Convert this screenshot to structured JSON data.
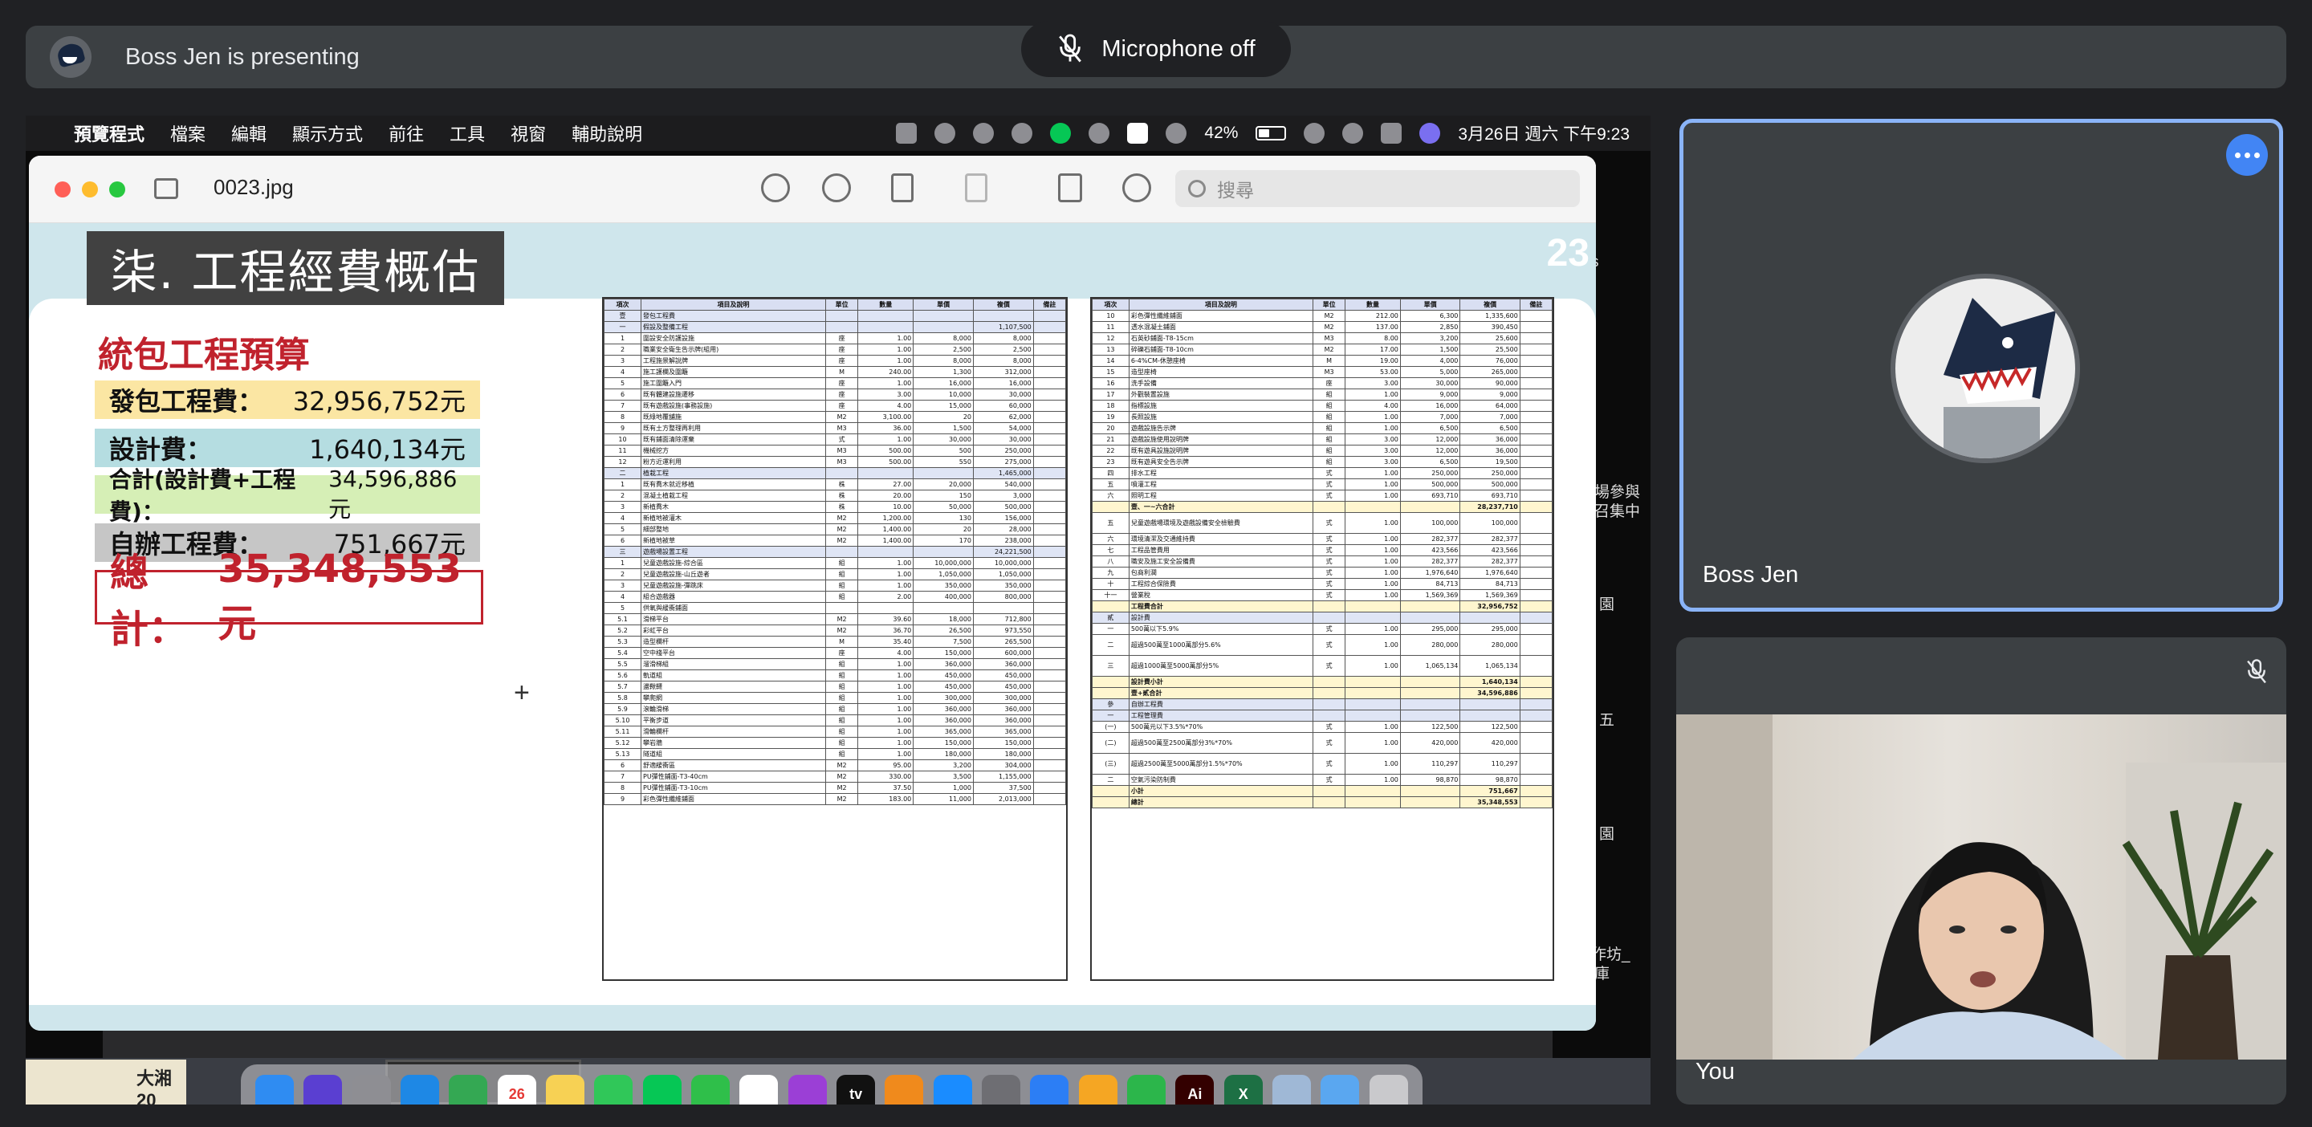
{
  "meet": {
    "presenting_text": "Boss Jen is presenting",
    "mic_status": "Microphone off",
    "tiles": [
      {
        "name": "Boss Jen"
      },
      {
        "name": "You"
      }
    ]
  },
  "mac": {
    "menubar": [
      "預覽程式",
      "檔案",
      "編輯",
      "顯示方式",
      "前往",
      "工具",
      "視窗",
      "輔助說明"
    ],
    "battery": "42%",
    "datetime": "3月26日 週六 下午9:23"
  },
  "preview": {
    "file_name": "0023.jpg",
    "search_placeholder": "搜尋"
  },
  "slide": {
    "page_number": "23",
    "title": "柒. 工程經費概估",
    "subtitle": "統包工程預算",
    "lines": [
      {
        "label": "發包工程費：",
        "value": "32,956,752元",
        "color": "#fbe6a3"
      },
      {
        "label": "設計費：",
        "value": "1,640,134元",
        "color": "#b5dde1"
      },
      {
        "label": "合計(設計費+工程費)：",
        "value": "34,596,886元",
        "color": "#d6efb6"
      },
      {
        "label": "自辦工程費：",
        "value": "751,667元",
        "color": "#c6c6c6"
      }
    ],
    "total_label": "總計：",
    "total_value": "35,348,553元",
    "sheet_headers": [
      "項次",
      "項目及說明",
      "單位",
      "數量",
      "單價",
      "複價",
      "備註"
    ],
    "sheet_left": [
      [
        "壹",
        "發包工程費",
        "",
        "",
        "",
        "",
        ""
      ],
      [
        "一",
        "假設及整備工程",
        "",
        "",
        "",
        "1,107,500",
        ""
      ],
      [
        "1",
        "圍設安全防護設施",
        "座",
        "1.00",
        "8,000",
        "8,000",
        ""
      ],
      [
        "2",
        "職業安全衛生告示牌(組用)",
        "座",
        "1.00",
        "2,500",
        "2,500",
        ""
      ],
      [
        "3",
        "工程施景解說牌",
        "座",
        "1.00",
        "8,000",
        "8,000",
        ""
      ],
      [
        "4",
        "施工護欄及圍籬",
        "M",
        "240.00",
        "1,300",
        "312,000",
        ""
      ],
      [
        "5",
        "施工圍籬入門",
        "座",
        "1.00",
        "16,000",
        "16,000",
        ""
      ],
      [
        "6",
        "既有體建設施遷移",
        "座",
        "3.00",
        "10,000",
        "30,000",
        ""
      ],
      [
        "7",
        "既有遊戲設施(事務設施)",
        "座",
        "4.00",
        "15,000",
        "60,000",
        ""
      ],
      [
        "8",
        "既綠地覆舖施",
        "M2",
        "3,100.00",
        "20",
        "62,000",
        ""
      ],
      [
        "9",
        "既有土方整理再利用",
        "M3",
        "36.00",
        "1,500",
        "54,000",
        ""
      ],
      [
        "10",
        "既有鋪面清除運棄",
        "式",
        "1.00",
        "30,000",
        "30,000",
        ""
      ],
      [
        "11",
        "機械挖方",
        "M3",
        "500.00",
        "500",
        "250,000",
        ""
      ],
      [
        "12",
        "粉方近運利用",
        "M3",
        "500.00",
        "550",
        "275,000",
        ""
      ],
      [
        "二",
        "植栽工程",
        "",
        "",
        "",
        "1,465,000",
        ""
      ],
      [
        "1",
        "既有喬木就近移植",
        "株",
        "27.00",
        "20,000",
        "540,000",
        ""
      ],
      [
        "2",
        "混凝土植栽工程",
        "株",
        "20.00",
        "150",
        "3,000",
        ""
      ],
      [
        "3",
        "新植喬木",
        "株",
        "10.00",
        "50,000",
        "500,000",
        ""
      ],
      [
        "4",
        "新植地被灌木",
        "M2",
        "1,200.00",
        "130",
        "156,000",
        ""
      ],
      [
        "5",
        "細部整地",
        "M2",
        "1,400.00",
        "20",
        "28,000",
        ""
      ],
      [
        "6",
        "新植地被草",
        "M2",
        "1,400.00",
        "170",
        "238,000",
        ""
      ],
      [
        "三",
        "遊戲場設置工程",
        "",
        "",
        "",
        "24,221,500",
        ""
      ],
      [
        "1",
        "兒童遊戲設施-綜合區",
        "組",
        "1.00",
        "10,000,000",
        "10,000,000",
        ""
      ],
      [
        "2",
        "兒童遊戲設施-山丘遊者",
        "組",
        "1.00",
        "1,050,000",
        "1,050,000",
        ""
      ],
      [
        "3",
        "兒童遊戲設施-彈跳床",
        "組",
        "1.00",
        "350,000",
        "350,000",
        ""
      ],
      [
        "4",
        "組合遊戲器",
        "組",
        "2.00",
        "400,000",
        "800,000",
        ""
      ],
      [
        "5",
        "供氧與緩衝鋪面",
        "",
        "",
        "",
        "",
        ""
      ],
      [
        "5.1",
        "滑梯平台",
        "M2",
        "39.60",
        "18,000",
        "712,800",
        ""
      ],
      [
        "5.2",
        "彩虹平台",
        "M2",
        "36.70",
        "26,500",
        "973,550",
        ""
      ],
      [
        "5.3",
        "造型欄杆",
        "M",
        "35.40",
        "7,500",
        "265,500",
        ""
      ],
      [
        "5.4",
        "空中棧平台",
        "座",
        "4.00",
        "150,000",
        "600,000",
        ""
      ],
      [
        "5.5",
        "溜滑梯組",
        "組",
        "1.00",
        "360,000",
        "360,000",
        ""
      ],
      [
        "5.6",
        "軌道組",
        "組",
        "1.00",
        "450,000",
        "450,000",
        ""
      ],
      [
        "5.7",
        "盪鞦韆",
        "組",
        "1.00",
        "450,000",
        "450,000",
        ""
      ],
      [
        "5.8",
        "攀爬網",
        "組",
        "1.00",
        "300,000",
        "300,000",
        ""
      ],
      [
        "5.9",
        "滾輪滑梯",
        "組",
        "1.00",
        "360,000",
        "360,000",
        ""
      ],
      [
        "5.10",
        "平衡步道",
        "組",
        "1.00",
        "360,000",
        "360,000",
        ""
      ],
      [
        "5.11",
        "滑輪欄杆",
        "組",
        "1.00",
        "365,000",
        "365,000",
        ""
      ],
      [
        "5.12",
        "攀岩牆",
        "組",
        "1.00",
        "150,000",
        "150,000",
        ""
      ],
      [
        "5.13",
        "隧道組",
        "組",
        "1.00",
        "180,000",
        "180,000",
        ""
      ],
      [
        "6",
        "舒適緩衝區",
        "M2",
        "95.00",
        "3,200",
        "304,000",
        ""
      ],
      [
        "7",
        "PU彈性鋪面-T3-40cm",
        "M2",
        "330.00",
        "3,500",
        "1,155,000",
        ""
      ],
      [
        "8",
        "PU彈性鋪面-T3-10cm",
        "M2",
        "37.50",
        "1,000",
        "37,500",
        ""
      ],
      [
        "9",
        "彩色彈性纖維鋪面",
        "M2",
        "183.00",
        "11,000",
        "2,013,000",
        ""
      ]
    ],
    "sheet_right": [
      [
        "10",
        "彩色彈性纖維鋪面",
        "M2",
        "212.00",
        "6,300",
        "1,335,600",
        ""
      ],
      [
        "11",
        "透水混凝土鋪面",
        "M2",
        "137.00",
        "2,850",
        "390,450",
        ""
      ],
      [
        "12",
        "石英砂鋪面-T8-15cm",
        "M3",
        "8.00",
        "3,200",
        "25,600",
        ""
      ],
      [
        "13",
        "碎礫石鋪面-T8-10cm",
        "M2",
        "17.00",
        "1,500",
        "25,500",
        ""
      ],
      [
        "14",
        "6-4%CM-休憩座椅",
        "M",
        "19.00",
        "4,000",
        "76,000",
        ""
      ],
      [
        "15",
        "造型座椅",
        "M3",
        "53.00",
        "5,000",
        "265,000",
        ""
      ],
      [
        "16",
        "洗手設備",
        "座",
        "3.00",
        "30,000",
        "90,000",
        ""
      ],
      [
        "17",
        "外觀裝置設施",
        "組",
        "1.00",
        "9,000",
        "9,000",
        ""
      ],
      [
        "18",
        "指標設施",
        "組",
        "4.00",
        "16,000",
        "64,000",
        ""
      ],
      [
        "19",
        "長照設施",
        "組",
        "1.00",
        "7,000",
        "7,000",
        ""
      ],
      [
        "20",
        "遊戲設施告示牌",
        "組",
        "1.00",
        "6,500",
        "6,500",
        ""
      ],
      [
        "21",
        "遊戲設施使用說明牌",
        "組",
        "3.00",
        "12,000",
        "36,000",
        ""
      ],
      [
        "22",
        "既有遊具設施說明牌",
        "組",
        "3.00",
        "12,000",
        "36,000",
        ""
      ],
      [
        "23",
        "既有遊具安全告示牌",
        "組",
        "3.00",
        "6,500",
        "19,500",
        ""
      ],
      [
        "四",
        "排水工程",
        "式",
        "1.00",
        "250,000",
        "250,000",
        ""
      ],
      [
        "五",
        "噴灌工程",
        "式",
        "1.00",
        "500,000",
        "500,000",
        ""
      ],
      [
        "六",
        "照明工程",
        "式",
        "1.00",
        "693,710",
        "693,710",
        ""
      ],
      [
        "",
        "壹、一~六合計",
        "",
        "",
        "",
        "28,237,710",
        ""
      ],
      [
        "五",
        "兒童遊戲場環境及遊戲設備安全檢驗費",
        "式",
        "1.00",
        "100,000",
        "100,000",
        ""
      ],
      [
        "六",
        "環境清潔及交通維持費",
        "式",
        "1.00",
        "282,377",
        "282,377",
        ""
      ],
      [
        "七",
        "工程品管費用",
        "式",
        "1.00",
        "423,566",
        "423,566",
        ""
      ],
      [
        "八",
        "職安及施工安全設備費",
        "式",
        "1.00",
        "282,377",
        "282,377",
        ""
      ],
      [
        "九",
        "包商利潤",
        "式",
        "1.00",
        "1,976,640",
        "1,976,640",
        ""
      ],
      [
        "十",
        "工程綜合保險費",
        "式",
        "1.00",
        "84,713",
        "84,713",
        ""
      ],
      [
        "十一",
        "營業稅",
        "式",
        "1.00",
        "1,569,369",
        "1,569,369",
        ""
      ],
      [
        "",
        "工程費合計",
        "",
        "",
        "",
        "32,956,752",
        ""
      ],
      [
        "貳",
        "設計費",
        "",
        "",
        "",
        "",
        ""
      ],
      [
        "一",
        "500萬以下5.9%",
        "式",
        "1.00",
        "295,000",
        "295,000",
        ""
      ],
      [
        "二",
        "超過500萬至1000萬部分5.6%",
        "式",
        "1.00",
        "280,000",
        "280,000",
        ""
      ],
      [
        "三",
        "超過1000萬至5000萬部分5%",
        "式",
        "1.00",
        "1,065,134",
        "1,065,134",
        ""
      ],
      [
        "",
        "設計費小計",
        "",
        "",
        "",
        "1,640,134",
        ""
      ],
      [
        "",
        "壹+貳合計",
        "",
        "",
        "",
        "34,596,886",
        ""
      ],
      [
        "參",
        "自辦工程費",
        "",
        "",
        "",
        "",
        ""
      ],
      [
        "一",
        "工程管理費",
        "",
        "",
        "",
        "",
        ""
      ],
      [
        "(一)",
        "500萬元以下3.5%*70%",
        "式",
        "1.00",
        "122,500",
        "122,500",
        ""
      ],
      [
        "(二)",
        "超過500萬至2500萬部分3%*70%",
        "式",
        "1.00",
        "420,000",
        "420,000",
        ""
      ],
      [
        "(三)",
        "超過2500萬至5000萬部分1.5%*70%",
        "式",
        "1.00",
        "110,297",
        "110,297",
        ""
      ],
      [
        "二",
        "空氣污染防制費",
        "式",
        "1.00",
        "98,870",
        "98,870",
        ""
      ],
      [
        "",
        "小計",
        "",
        "",
        "",
        "751,667",
        ""
      ],
      [
        "",
        "總計",
        "",
        "",
        "",
        "35,348,553",
        ""
      ]
    ]
  },
  "dock": [
    {
      "name": "finder-icon",
      "color": "#2f8cf2",
      "label": ""
    },
    {
      "name": "siri-icon",
      "color": "#5a3fd1",
      "label": ""
    },
    {
      "name": "launchpad-icon",
      "color": "#8e8e93",
      "label": ""
    },
    {
      "name": "safari-icon",
      "color": "#1e88e5",
      "label": ""
    },
    {
      "name": "chrome-icon",
      "color": "#34a853",
      "label": ""
    },
    {
      "name": "calendar-icon",
      "color": "#ffffff",
      "label": "26"
    },
    {
      "name": "notes-icon",
      "color": "#f7d154",
      "label": ""
    },
    {
      "name": "messages-icon",
      "color": "#30c759",
      "label": ""
    },
    {
      "name": "line-icon",
      "color": "#06c755",
      "label": ""
    },
    {
      "name": "facetime-icon",
      "color": "#2fbf4a",
      "label": ""
    },
    {
      "name": "slack-icon",
      "color": "#ffffff",
      "label": ""
    },
    {
      "name": "podcasts-icon",
      "color": "#9b3fd6",
      "label": ""
    },
    {
      "name": "tv-icon",
      "color": "#111111",
      "label": "tv"
    },
    {
      "name": "books-icon",
      "color": "#f08a1c",
      "label": ""
    },
    {
      "name": "appstore-icon",
      "color": "#1a8cff",
      "label": ""
    },
    {
      "name": "system-preferences-icon",
      "color": "#6e6e73",
      "label": ""
    },
    {
      "name": "keynote-icon",
      "color": "#2c7ef5",
      "label": ""
    },
    {
      "name": "pages-icon",
      "color": "#f5a623",
      "label": ""
    },
    {
      "name": "numbers-icon",
      "color": "#2cb64b",
      "label": ""
    },
    {
      "name": "illustrator-icon",
      "color": "#330000",
      "label": "Ai"
    },
    {
      "name": "excel-icon",
      "color": "#1d7044",
      "label": "X"
    },
    {
      "name": "preview-icon",
      "color": "#9fb8d6",
      "label": ""
    },
    {
      "name": "folder-icon",
      "color": "#5aa7f0",
      "label": ""
    },
    {
      "name": "trash-icon",
      "color": "#c9c9cc",
      "label": ""
    }
  ]
}
